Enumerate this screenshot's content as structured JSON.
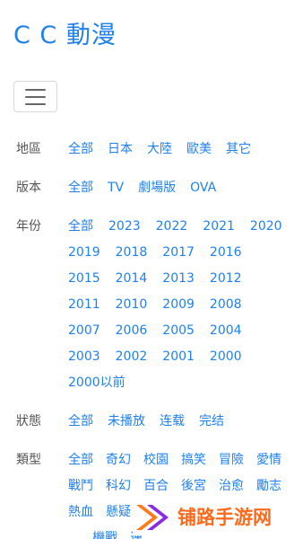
{
  "brand": {
    "title": "C C 動漫"
  },
  "navbar": {
    "toggle_icon": "menu-icon"
  },
  "filters": {
    "region": {
      "label": "地區",
      "items": [
        "全部",
        "日本",
        "大陸",
        "歐美",
        "其它"
      ]
    },
    "version": {
      "label": "版本",
      "items": [
        "全部",
        "TV",
        "劇場版",
        "OVA"
      ]
    },
    "year": {
      "label": "年份",
      "items": [
        "全部",
        "2023",
        "2022",
        "2021",
        "2020",
        "2019",
        "2018",
        "2017",
        "2016",
        "2015",
        "2014",
        "2013",
        "2012",
        "2011",
        "2010",
        "2009",
        "2008",
        "2007",
        "2006",
        "2005",
        "2004",
        "2003",
        "2002",
        "2001",
        "2000",
        "2000以前"
      ]
    },
    "status": {
      "label": "狀態",
      "items": [
        "全部",
        "未播放",
        "连载",
        "完结"
      ]
    },
    "type": {
      "label": "類型",
      "items": [
        "全部",
        "奇幻",
        "校園",
        "搞笑",
        "冒險",
        "愛情",
        "戰鬥",
        "科幻",
        "百合",
        "後宮",
        "治愈",
        "勵志",
        "熱血",
        "懸疑",
        "競技",
        "神魔",
        "歌",
        "",
        "",
        "",
        "機戰",
        "運"
      ]
    }
  },
  "watermark": {
    "text": "铺路手游网"
  },
  "colors": {
    "link": "#1f80f0",
    "label": "#555555",
    "watermark": "#ff6a1a"
  }
}
